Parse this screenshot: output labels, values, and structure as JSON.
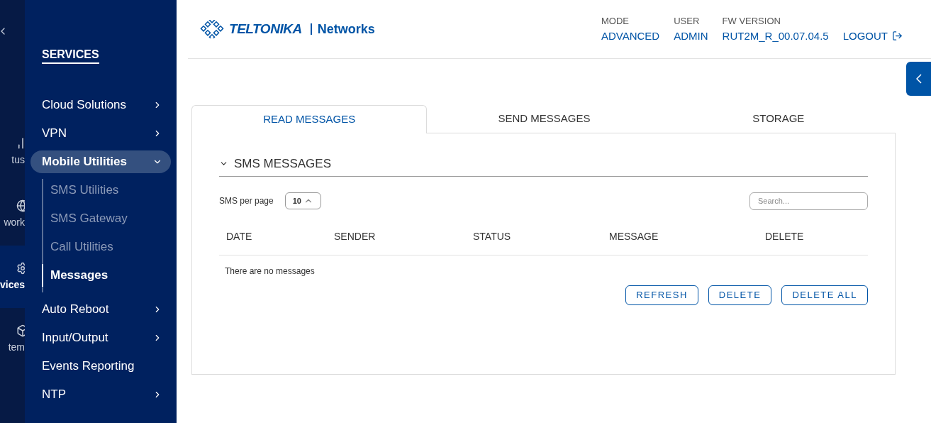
{
  "rail": {
    "items": [
      {
        "label": "tus",
        "selected": false
      },
      {
        "label": "work",
        "selected": false
      },
      {
        "label": "vices",
        "selected": true
      },
      {
        "label": "tem",
        "selected": false
      }
    ]
  },
  "sidebar": {
    "title": "SERVICES",
    "items": [
      {
        "label": "Cloud Solutions",
        "has_submenu": true,
        "expanded": false
      },
      {
        "label": "VPN",
        "has_submenu": true,
        "expanded": false
      },
      {
        "label": "Mobile Utilities",
        "has_submenu": true,
        "expanded": true,
        "children": [
          {
            "label": "SMS Utilities",
            "selected": false
          },
          {
            "label": "SMS Gateway",
            "selected": false
          },
          {
            "label": "Call Utilities",
            "selected": false
          },
          {
            "label": "Messages",
            "selected": true
          }
        ]
      },
      {
        "label": "Auto Reboot",
        "has_submenu": true,
        "expanded": false
      },
      {
        "label": "Input/Output",
        "has_submenu": true,
        "expanded": false
      },
      {
        "label": "Events Reporting",
        "has_submenu": false,
        "expanded": false
      },
      {
        "label": "NTP",
        "has_submenu": true,
        "expanded": false
      }
    ]
  },
  "header": {
    "brand": "TELTONIKA",
    "product": "Networks",
    "info": [
      {
        "label": "MODE",
        "value": "ADVANCED"
      },
      {
        "label": "USER",
        "value": "ADMIN"
      },
      {
        "label": "FW VERSION",
        "value": "RUT2M_R_00.07.04.5"
      }
    ],
    "logout": "LOGOUT"
  },
  "tabs": [
    {
      "label": "READ MESSAGES",
      "selected": true
    },
    {
      "label": "SEND MESSAGES",
      "selected": false
    },
    {
      "label": "STORAGE",
      "selected": false
    }
  ],
  "section": {
    "title": "SMS MESSAGES",
    "expanded": true
  },
  "per_page": {
    "label": "SMS per page",
    "value": "10"
  },
  "search": {
    "placeholder": "Search..."
  },
  "table": {
    "columns": [
      "DATE",
      "SENDER",
      "STATUS",
      "MESSAGE",
      "DELETE"
    ],
    "empty": "There are no messages"
  },
  "buttons": [
    "REFRESH",
    "DELETE",
    "DELETE ALL"
  ]
}
